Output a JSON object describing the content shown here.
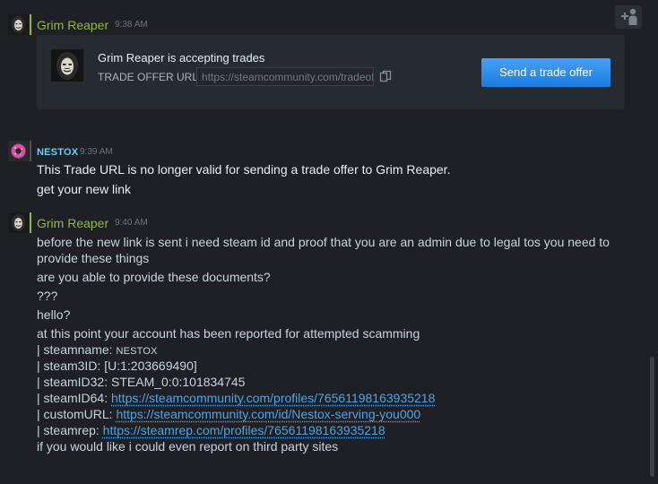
{
  "messages": {
    "m1": {
      "author": "Grim Reaper",
      "time": "9:38 AM"
    },
    "trade": {
      "title": "Grim Reaper is accepting trades",
      "url_label": "TRADE OFFER URL:",
      "url_value": "https://steamcommunity.com/tradeoffer/new/",
      "button": "Send a trade offer"
    },
    "m2": {
      "author": "NESTOX",
      "time": "9:39 AM",
      "lines": [
        "This Trade URL is no longer valid for sending a trade offer to Grim Reaper.",
        "get your new link"
      ]
    },
    "m3": {
      "author": "Grim Reaper",
      "time": "9:40 AM",
      "l1": "before the new link is sent i need steam id and proof that you are an admin due to legal tos you need to provide these things",
      "l2": "are you able to provide these documents?",
      "l3": "???",
      "l4": "hello?",
      "l5": "at this point your account has been reported for attempted scamming",
      "steamname_label": "| steamname: ",
      "steamname_value": "NESTOX",
      "steam3id": "| steam3ID: [U:1:203669490]",
      "steamid32": "| steamID32: STEAM_0:0:101834745",
      "steamid64_label": "| steamID64: ",
      "steamid64_link": "https://steamcommunity.com/profiles/76561198163935218",
      "customurl_label": "| customURL: ",
      "customurl_link": "https://steamcommunity.com/id/Nestox-serving-you000",
      "steamrep_label": "| steamrep: ",
      "steamrep_link": "https://steamrep.com/profiles/76561198163935218",
      "l_last": "if you would like i could even report on third party sites"
    }
  },
  "colors": {
    "grim_name": "#8fb93b",
    "nestox_name": "#6dcff6",
    "link": "#53a4e0",
    "button": "#1a7be0"
  },
  "icons": {
    "copy": "copy-icon",
    "add_friend": "add-friend-icon"
  }
}
